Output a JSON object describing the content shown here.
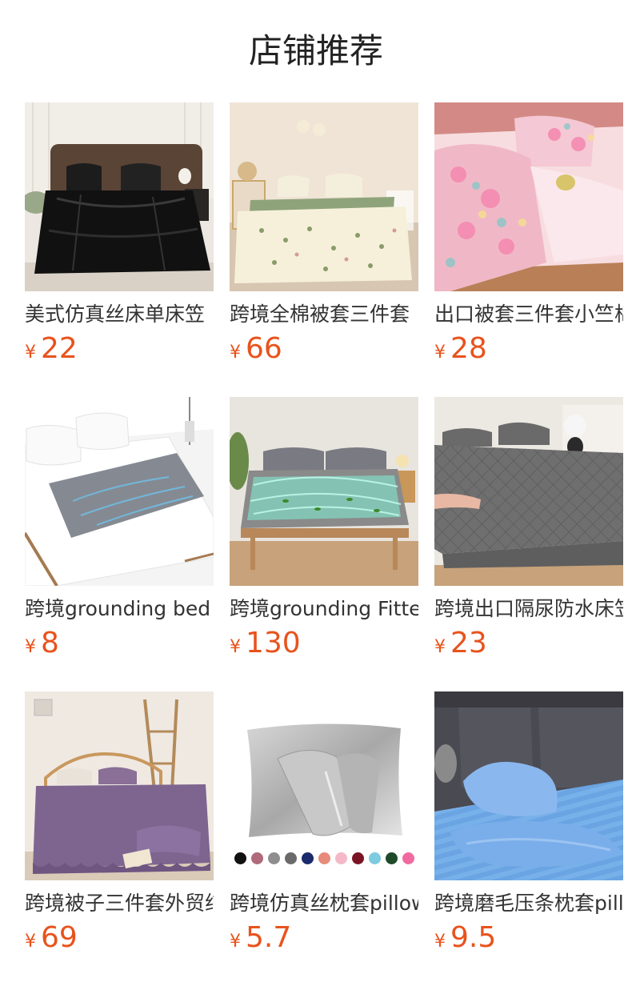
{
  "page": {
    "title": "店铺推荐"
  },
  "currency_symbol": "¥",
  "colors": {
    "price": "#e8531c",
    "text": "#333333"
  },
  "products": [
    {
      "name": "美式仿真丝床单床笠",
      "price": "22",
      "image": "black-silk-bedsheet"
    },
    {
      "name": "跨境全棉被套三件套",
      "price": "66",
      "image": "floral-cream-duvet"
    },
    {
      "name": "出口被套三件套小竺棉",
      "price": "28",
      "image": "pink-floral-duvet"
    },
    {
      "name": "跨境grounding bed",
      "price": "8",
      "image": "grounding-bed-sheet"
    },
    {
      "name": "跨境grounding Fitted",
      "price": "130",
      "image": "grounding-fitted-sheet"
    },
    {
      "name": "跨境出口隔尿防水床笠",
      "price": "23",
      "image": "grey-quilted-protector"
    },
    {
      "name": "跨境被子三件套外贸纯色",
      "price": "69",
      "image": "purple-ruffle-comforter"
    },
    {
      "name": "跨境仿真丝枕套pillowcase",
      "price": "5.7",
      "image": "silver-silk-pillowcase"
    },
    {
      "name": "跨境磨毛压条枕套pillowcase",
      "price": "9.5",
      "image": "blue-stripe-pillowcase"
    }
  ],
  "pillowcase_swatches": [
    "#111111",
    "#b06a7a",
    "#8e8e8e",
    "#6a6a6a",
    "#1a2a6a",
    "#e88a7a",
    "#f4b8c8",
    "#7a1424",
    "#7ccbe0",
    "#1f4a2a",
    "#f06aa0"
  ]
}
